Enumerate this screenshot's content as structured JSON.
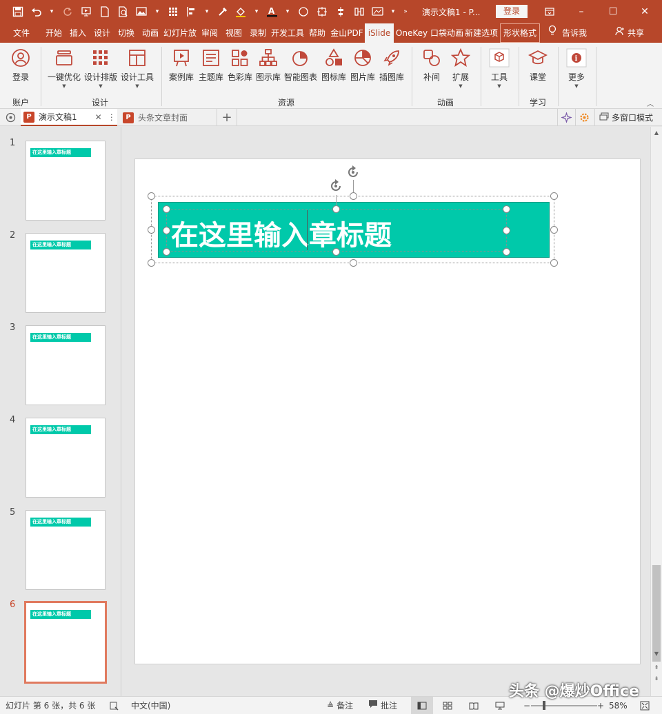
{
  "titlebar": {
    "doc_title": "演示文稿1 - P...",
    "login": "登录",
    "quick_access": [
      "save-icon",
      "undo-icon",
      "redo-icon",
      "slideshow-icon",
      "new-icon",
      "print-preview-icon",
      "picture-icon",
      "grid-icon",
      "align-icon",
      "eyedropper-icon",
      "fill-icon",
      "font-color-icon",
      "shape-icon",
      "crop-icon",
      "distribute-icon",
      "connect-icon",
      "gallery-icon",
      "more-icon"
    ],
    "window": {
      "restore": "ribbon-display-icon",
      "minimize": "–",
      "maximize": "☐",
      "close": "✕"
    },
    "colors": {
      "accent": "#b7472a"
    }
  },
  "tabs": [
    {
      "label": "文件"
    },
    {
      "label": "开始"
    },
    {
      "label": "插入"
    },
    {
      "label": "设计"
    },
    {
      "label": "切换"
    },
    {
      "label": "动画"
    },
    {
      "label": "幻灯片放"
    },
    {
      "label": "审阅"
    },
    {
      "label": "视图"
    },
    {
      "label": "录制"
    },
    {
      "label": "开发工具"
    },
    {
      "label": "帮助"
    },
    {
      "label": "金山PDF"
    },
    {
      "label": "iSlide"
    },
    {
      "label": "OneKey"
    },
    {
      "label": "口袋动画"
    },
    {
      "label": "新建选项"
    },
    {
      "label": "形状格式"
    }
  ],
  "tell_me": "告诉我",
  "share": "共享",
  "ribbon": {
    "buttons": {
      "login": "登录",
      "one_click": "一键优化",
      "layout": "设计排版",
      "tools": "设计工具",
      "cases": "案例库",
      "themes": "主题库",
      "colors": "色彩库",
      "diagrams": "图示库",
      "charts": "智能图表",
      "icons": "图标库",
      "images": "图片库",
      "illustrations": "插图库",
      "tween": "补间",
      "extend": "扩展",
      "tool": "工具",
      "course": "课堂",
      "more": "更多"
    },
    "groups": {
      "account": "账户",
      "design": "设计",
      "resources": "资源",
      "animation": "动画",
      "learn": "学习"
    }
  },
  "doc_tabs": {
    "tab1": "演示文稿1",
    "tab2": "头条文章封面",
    "multi_window": "多窗口模式"
  },
  "slides": {
    "numbers": [
      "1",
      "2",
      "3",
      "4",
      "5",
      "6"
    ],
    "thumb_text": "在这里输入章标题",
    "current": "6"
  },
  "slide": {
    "title": "在这里输入章标题",
    "title_bg": "#00c9aa"
  },
  "statusbar": {
    "slide_info": "幻灯片 第 6 张，共 6 张",
    "language": "中文(中国)",
    "notes": "备注",
    "comments": "批注",
    "zoom": "58%"
  },
  "watermark": "头条 @爆炒Office"
}
